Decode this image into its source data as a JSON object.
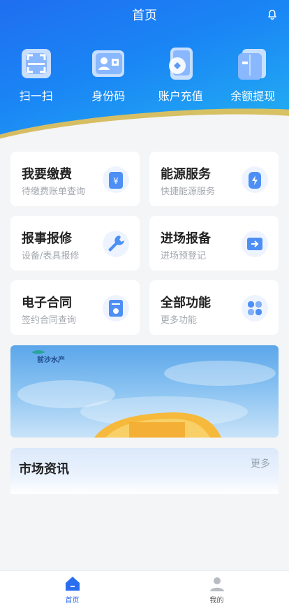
{
  "header": {
    "title": "首页",
    "bell_icon": "bell-icon"
  },
  "quick_actions": [
    {
      "label": "扫一扫",
      "icon": "scan-icon"
    },
    {
      "label": "身份码",
      "icon": "id-code-icon"
    },
    {
      "label": "账户充值",
      "icon": "recharge-icon"
    },
    {
      "label": "余额提现",
      "icon": "withdraw-icon"
    }
  ],
  "services": [
    {
      "title": "我要缴费",
      "subtitle": "待缴费账单查询",
      "icon": "payment-icon"
    },
    {
      "title": "能源服务",
      "subtitle": "快捷能源服务",
      "icon": "energy-icon"
    },
    {
      "title": "报事报修",
      "subtitle": "设备/表具报修",
      "icon": "wrench-icon"
    },
    {
      "title": "进场报备",
      "subtitle": "进场预登记",
      "icon": "entry-icon"
    },
    {
      "title": "电子合同",
      "subtitle": "签约合同查询",
      "icon": "contract-icon"
    },
    {
      "title": "全部功能",
      "subtitle": "更多功能",
      "icon": "all-functions-icon"
    }
  ],
  "banner": {
    "logo_text": "前沙水产"
  },
  "news": {
    "title": "市场资讯",
    "more": "更多"
  },
  "tabbar": [
    {
      "label": "首页",
      "icon": "home-icon",
      "active": true
    },
    {
      "label": "我的",
      "icon": "profile-icon",
      "active": false
    }
  ],
  "colors": {
    "primary": "#1f6ef0",
    "accent": "#f7c64a",
    "tab_active": "#2a6ef0",
    "tab_inactive": "#555555"
  }
}
